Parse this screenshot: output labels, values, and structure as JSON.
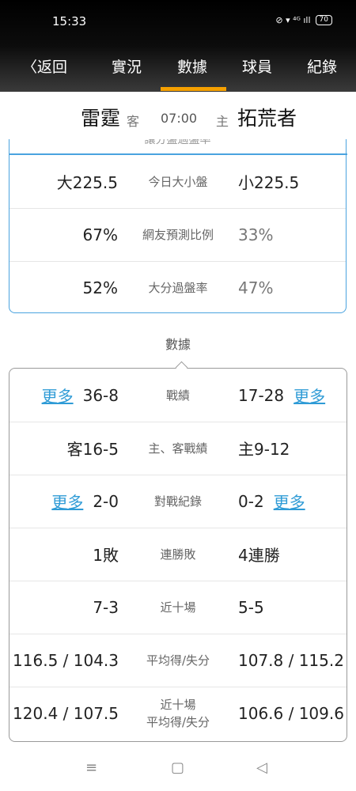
{
  "status": {
    "time": "15:33",
    "signal_icons": "⊘ ▾ ⁴ᴳ ıll",
    "battery": "70"
  },
  "nav": {
    "back_label": "返回",
    "tabs": [
      {
        "label": "實況"
      },
      {
        "label": "數據"
      },
      {
        "label": "球員"
      },
      {
        "label": "紀錄"
      }
    ],
    "active_tab": "數據",
    "accent_color": "#f5a000"
  },
  "match": {
    "away_team": "雷霆",
    "away_tag": "客",
    "time": "07:00",
    "home_tag": "主",
    "home_team": "拓荒者"
  },
  "betting": {
    "partial_header": "讓分盤過盤率",
    "rows": [
      {
        "left": "大225.5",
        "label": "今日大小盤",
        "right": "小225.5"
      },
      {
        "left": "67%",
        "label": "網友預測比例",
        "right": "33%"
      },
      {
        "left": "52%",
        "label": "大分過盤率",
        "right": "47%"
      }
    ]
  },
  "stats": {
    "section_title": "數據",
    "more_label": "更多",
    "rows": [
      {
        "left": "36-8",
        "label": "戰績",
        "right": "17-28"
      },
      {
        "left": "客16-5",
        "label": "主、客戰績",
        "right": "主9-12"
      },
      {
        "left": "2-0",
        "label": "對戰紀錄",
        "right": "0-2"
      },
      {
        "left": "1敗",
        "label": "連勝敗",
        "right": "4連勝"
      },
      {
        "left": "7-3",
        "label": "近十場",
        "right": "5-5"
      },
      {
        "left": "116.5 / 104.3",
        "label": "平均得/失分",
        "right": "107.8 / 115.2"
      },
      {
        "left": "120.4 / 107.5",
        "label": "近十場\n平均得/失分",
        "right": "106.6 / 109.6"
      }
    ]
  },
  "system_nav": {
    "menu_icon": "≡",
    "home_icon": "▢",
    "back_icon": "◁"
  }
}
